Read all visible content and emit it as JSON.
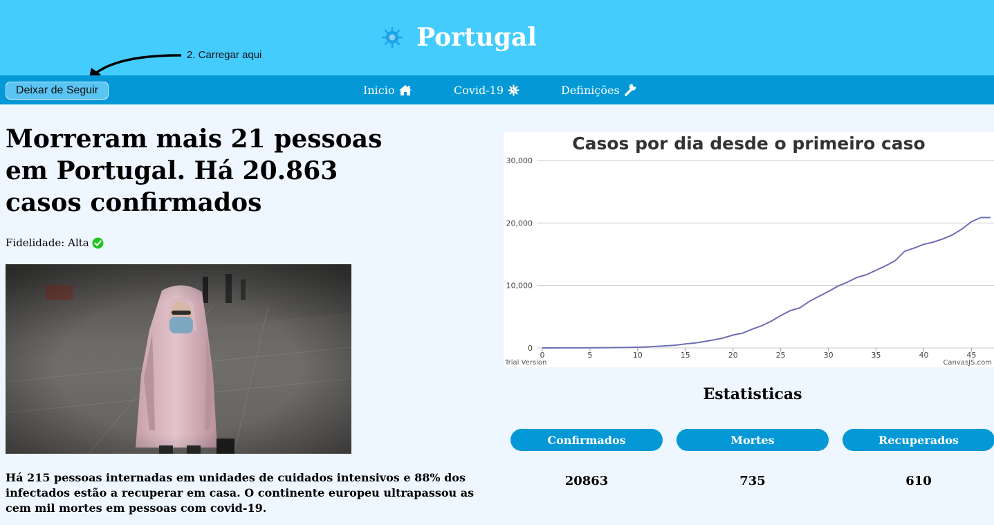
{
  "header": {
    "title": "Portugal",
    "annotation": "2. Carregar aqui",
    "logo_icon": "coronavirus-icon"
  },
  "nav": {
    "unfollow_label": "Deixar de Seguir",
    "items": [
      {
        "label": "Inicio",
        "icon": "home-icon"
      },
      {
        "label": "Covid-19",
        "icon": "virus-icon"
      },
      {
        "label": "Definições",
        "icon": "wrench-icon"
      }
    ]
  },
  "article": {
    "headline": "Morreram mais 21 pessoas em Portugal. Há 20.863 casos confirmados",
    "fidelity_label": "Fidelidade: Alta",
    "fidelity_icon": "check-circle-icon",
    "summary": "Há 215 pessoas internadas em unidades de cuidados intensivos e 88% dos infectados estão a recuperar em casa. O continente europeu ultrapassou as cem mil mortes em pessoas com covid-19."
  },
  "chart_data": {
    "type": "line",
    "title": "Casos por dia desde o primeiro caso",
    "xlabel": "",
    "ylabel": "",
    "xlim": [
      0,
      47
    ],
    "ylim": [
      0,
      30000
    ],
    "x_ticks": [
      "0",
      "5",
      "10",
      "15",
      "20",
      "25",
      "30",
      "35",
      "40",
      "45"
    ],
    "y_ticks": [
      "0",
      "10,000",
      "20,000",
      "30,000"
    ],
    "grid": true,
    "line_color": "#6d6db3",
    "watermark_left": "Trial Version",
    "watermark_right": "CanvasJS.com",
    "x": [
      0,
      1,
      2,
      3,
      4,
      5,
      6,
      7,
      8,
      9,
      10,
      11,
      12,
      13,
      14,
      15,
      16,
      17,
      18,
      19,
      20,
      21,
      22,
      23,
      24,
      25,
      26,
      27,
      28,
      29,
      30,
      31,
      32,
      33,
      34,
      35,
      36,
      37,
      38,
      39,
      40,
      41,
      42,
      43,
      44,
      45,
      46,
      47
    ],
    "values": [
      2,
      4,
      6,
      9,
      13,
      21,
      30,
      41,
      59,
      78,
      112,
      169,
      245,
      331,
      448,
      642,
      785,
      1020,
      1280,
      1600,
      2060,
      2362,
      2995,
      3544,
      4268,
      5170,
      5962,
      6408,
      7443,
      8251,
      9034,
      9886,
      10524,
      11278,
      11730,
      12442,
      13141,
      13956,
      15472,
      15987,
      16585,
      16934,
      17448,
      18091,
      19022,
      20206,
      20863,
      20863
    ]
  },
  "stats": {
    "title": "Estatisticas",
    "items": [
      {
        "label": "Confirmados",
        "value": "20863"
      },
      {
        "label": "Mortes",
        "value": "735"
      },
      {
        "label": "Recuperados",
        "value": "610"
      }
    ]
  }
}
